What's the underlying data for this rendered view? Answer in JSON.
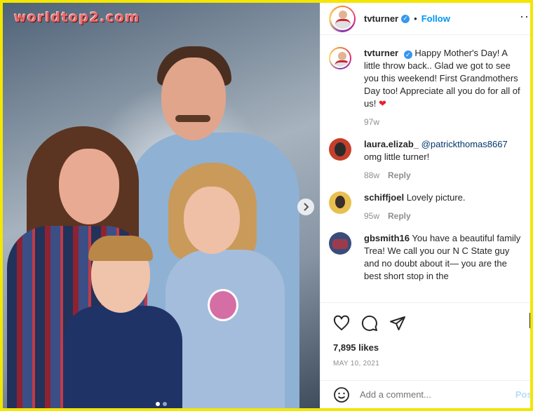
{
  "watermark": "worldtop2.com",
  "header": {
    "username": "tvturner",
    "bullet": "•",
    "follow_label": "Follow",
    "more_label": "···"
  },
  "caption": {
    "username": "tvturner",
    "text": "Happy Mother's Day! A little throw back.. Glad we got to see you this weekend! First Grandmothers Day too! Appreciate all you do for all of us!",
    "time": "97w"
  },
  "comments": [
    {
      "username": "laura.elizab_",
      "mention": "@patrickthomas8667",
      "text": "omg little turner!",
      "time": "88w",
      "reply_label": "Reply"
    },
    {
      "username": "schiffjoel",
      "text": "Lovely picture.",
      "time": "95w",
      "reply_label": "Reply"
    },
    {
      "username": "gbsmith16",
      "text": "You have a beautiful family Trea! We call you our N C State guy and no doubt about it— you are the best short stop in the"
    }
  ],
  "likes": "7,895 likes",
  "date": "MAY 10, 2021",
  "add_comment": {
    "placeholder": "Add a comment...",
    "post_label": "Post"
  },
  "icons": {
    "heart": "heart-icon",
    "comment": "comment-icon",
    "share": "share-icon",
    "bookmark": "bookmark-icon",
    "emoji": "emoji-icon",
    "next": "chevron-right-icon"
  },
  "colors": {
    "accent": "#0095f6",
    "verified": "#3797f0",
    "frame": "#f3e600",
    "heart_emoji": "#ed1c2e"
  },
  "carousel": {
    "total": 2,
    "active_index": 0
  }
}
